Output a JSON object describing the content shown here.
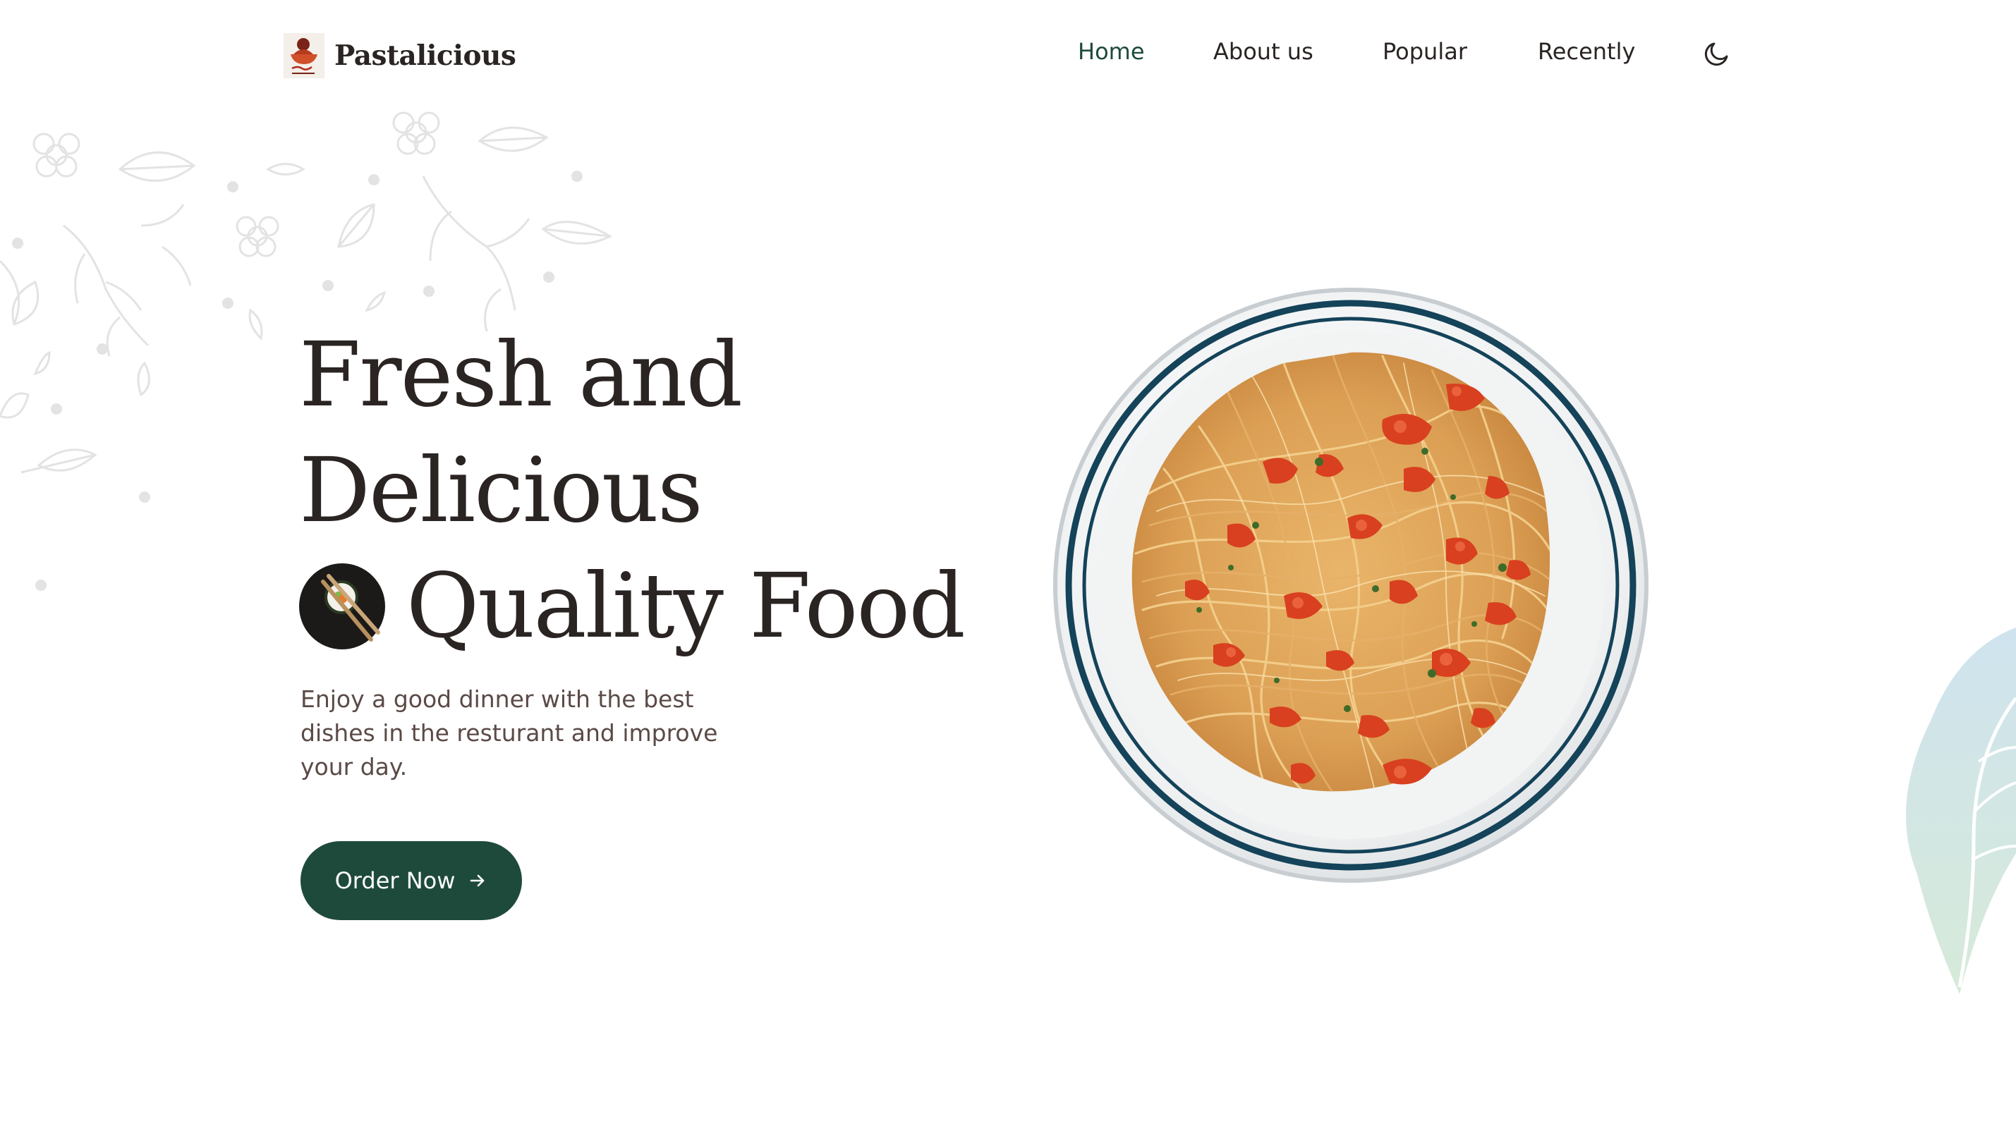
{
  "brand": {
    "name": "Pastalicious",
    "logo_icon": "pasta-bowl-logo-icon"
  },
  "nav": {
    "items": [
      {
        "label": "Home",
        "active": true
      },
      {
        "label": "About us",
        "active": false
      },
      {
        "label": "Popular",
        "active": false
      },
      {
        "label": "Recently",
        "active": false
      }
    ],
    "theme_toggle_icon": "moon-icon"
  },
  "hero": {
    "title_line1": "Fresh and",
    "title_line2": "Delicious",
    "title_line3": "Quality Food",
    "title_badge_icon": "sushi-chopsticks-icon",
    "description": "Enjoy a good dinner with the best dishes in the resturant and improve your day.",
    "cta_label": "Order Now",
    "cta_icon": "arrow-right-icon",
    "image": "spaghetti-plate-image"
  },
  "colors": {
    "accent": "#1e4a3c",
    "text": "#2a2422",
    "muted_text": "#5a4a46",
    "background": "#ffffff",
    "plate_rim": "#14435a"
  }
}
